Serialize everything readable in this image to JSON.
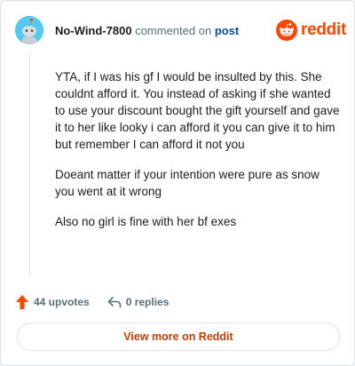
{
  "header": {
    "username": "No-Wind-7800",
    "commented_on": "commented on",
    "post_link": "post",
    "brand": "reddit"
  },
  "comment": {
    "paragraphs": [
      "YTA, if I was his gf I would be insulted by this. She couldnt afford it. You instead of asking if she wanted to use your discount bought the gift yourself and gave it to her like looky i can afford it you can give it to him but remember I can afford it not you",
      "Doeant matter if your intention were pure as snow you went at it wrong",
      "Also no girl is fine with her bf exes"
    ]
  },
  "footer": {
    "upvotes": "44 upvotes",
    "replies": "0 replies",
    "view_more": "View more on Reddit"
  },
  "colors": {
    "accent": "#ff4500",
    "avatar_bg": "#56c9ee",
    "link": "#0a4b9b"
  },
  "icons": {
    "avatar": "snoo-avatar-icon",
    "logo": "reddit-alien-icon",
    "upvote": "upvote-arrow-icon",
    "reply": "reply-arrow-icon"
  }
}
